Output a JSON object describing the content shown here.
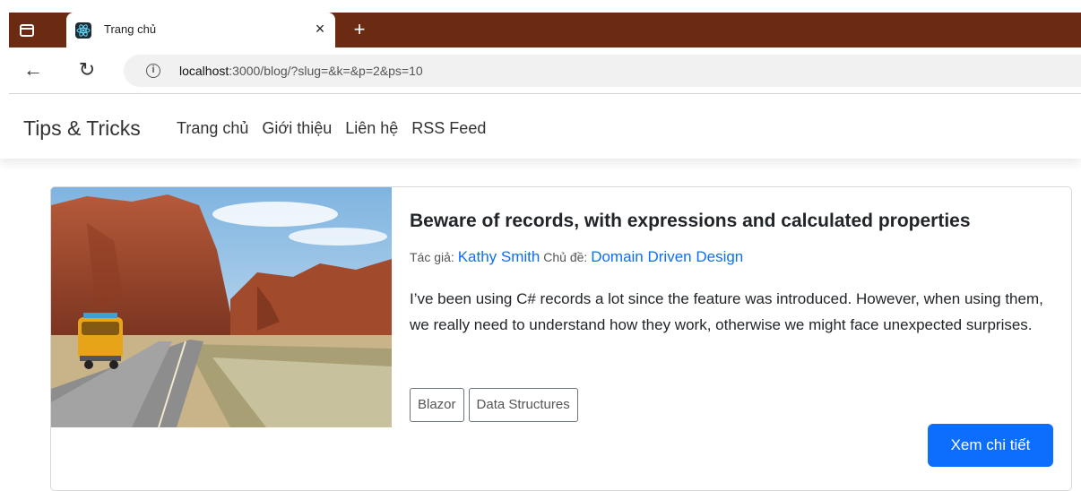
{
  "browser": {
    "tab_title": "Trang chủ",
    "tab_close": "×",
    "new_tab": "+",
    "url_host": "localhost",
    "url_path": ":3000/blog/?slug=&k=&p=2&ps=10"
  },
  "site": {
    "brand": "Tips & Tricks",
    "menu": [
      "Trang chủ",
      "Giới thiệu",
      "Liên hệ",
      "RSS Feed"
    ]
  },
  "post": {
    "title": "Beware of records, with expressions and calculated properties",
    "author_label": "Tác giả:",
    "author": "Kathy Smith",
    "category_label": "Chủ đề:",
    "category": "Domain Driven Design",
    "description": "I’ve been using C# records a lot since the feature was introduced. However, when using them, we really need to understand how they work, otherwise we might face unexpected surprises.",
    "tags": [
      "Blazor",
      "Data Structures"
    ],
    "detail_button": "Xem chi tiết"
  },
  "colors": {
    "tabbar": "#6b2a12",
    "link": "#0d6efd",
    "button": "#0d6efd"
  },
  "icons": {
    "tab_actions": "tab-actions-icon",
    "favicon": "react-icon",
    "back": "back-arrow-icon",
    "reload": "reload-icon",
    "info": "info-icon"
  }
}
